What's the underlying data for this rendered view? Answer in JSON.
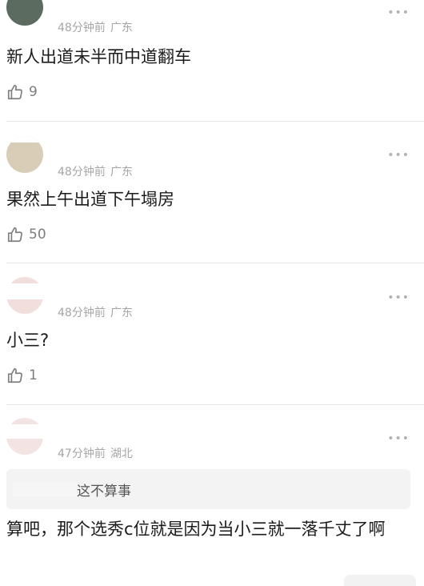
{
  "comments": [
    {
      "meta_time": "48分钟前",
      "meta_location": "广东",
      "text": "新人出道未半而中道翻车",
      "likes": "9",
      "more": "•••"
    },
    {
      "meta_time": "48分钟前",
      "meta_location": "广东",
      "text": "果然上午出道下午塌房",
      "likes": "50",
      "more": "•••"
    },
    {
      "meta_time": "48分钟前",
      "meta_location": "广东",
      "text": "小三?",
      "likes": "1",
      "more": "•••"
    },
    {
      "meta_time": "47分钟前",
      "meta_location": "湖北",
      "reply_quote": "这不算事",
      "text": "算吧，那个选秀c位就是因为当小三就一落千丈了啊",
      "more": "•••"
    }
  ],
  "colors": {
    "meta": "#a6a6a6",
    "text": "#1c1c1c",
    "divider": "#e6e6e6",
    "reply_bg": "#f3f3f3"
  }
}
